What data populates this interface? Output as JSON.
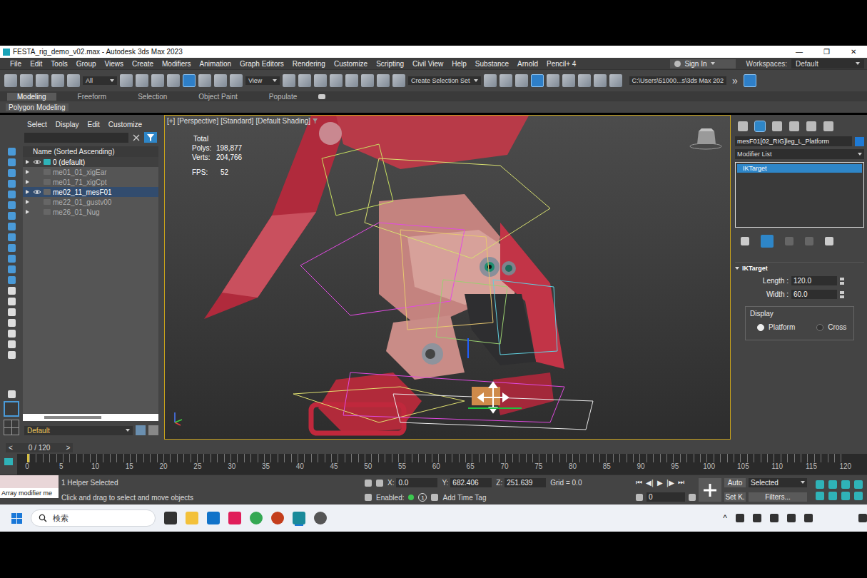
{
  "window": {
    "title": "FESTA_rig_demo_v02.max - Autodesk 3ds Max 2023",
    "controls": [
      "—",
      "❐",
      "✕"
    ]
  },
  "menu": [
    "File",
    "Edit",
    "Tools",
    "Group",
    "Views",
    "Create",
    "Modifiers",
    "Animation",
    "Graph Editors",
    "Rendering",
    "Customize",
    "Scripting",
    "Civil View",
    "Help",
    "Substance",
    "Arnold",
    "Pencil+ 4"
  ],
  "account": {
    "sign_in": "Sign In",
    "workspaces_label": "Workspaces:",
    "workspace": "Default"
  },
  "toolbar": {
    "selection_filter": "All",
    "reference_coord": "View",
    "selection_set": "Create Selection Set",
    "project_path": "C:\\Users\\51000...s\\3ds Max 202",
    "more": "»"
  },
  "ribbon": {
    "tabs": [
      {
        "label": "Modeling",
        "selected": true
      },
      {
        "label": "Freeform",
        "selected": false
      },
      {
        "label": "Selection",
        "selected": false
      },
      {
        "label": "Object Paint",
        "selected": false
      },
      {
        "label": "Populate",
        "selected": false
      }
    ],
    "panel": "Polygon Modeling"
  },
  "scene_explorer": {
    "menu": [
      "Select",
      "Display",
      "Edit",
      "Customize"
    ],
    "search_value": "",
    "column": "Name (Sorted Ascending)",
    "rows": [
      {
        "name": "0 (default)",
        "visible": true,
        "selected": false
      },
      {
        "name": "me01_01_xigEar",
        "visible": false,
        "selected": false
      },
      {
        "name": "me01_71_xigCpt",
        "visible": false,
        "selected": false
      },
      {
        "name": "me02_11_mesF01",
        "visible": true,
        "selected": true
      },
      {
        "name": "me22_01_gustv00",
        "visible": false,
        "selected": false
      },
      {
        "name": "me26_01_Nug",
        "visible": false,
        "selected": false
      }
    ],
    "layer": "Default"
  },
  "viewport": {
    "labels": [
      "[+]",
      "[Perspective]",
      "[Standard]",
      "[Default Shading]"
    ],
    "stats_title": "Total",
    "stats": [
      {
        "label": "Polys:",
        "value": "198,877"
      },
      {
        "label": "Verts:",
        "value": "204,766"
      }
    ],
    "fps_label": "FPS:",
    "fps": "52"
  },
  "command_panel": {
    "object_name": "mesF01[02_RIG]leg_L_Platform",
    "modifier_list": "Modifier List",
    "stack": [
      {
        "name": "IKTarget",
        "selected": true
      }
    ],
    "rollout": {
      "title": "IKTarget",
      "fields": [
        {
          "label": "Length :",
          "value": "120.0"
        },
        {
          "label": "Width :",
          "value": "60.0"
        }
      ],
      "group": "Display",
      "options": [
        {
          "label": "Platform",
          "selected": true
        },
        {
          "label": "Cross",
          "selected": false
        }
      ]
    }
  },
  "time_slider": {
    "label": "0 / 120",
    "prev": "<",
    "next": ">",
    "level": 0
  },
  "track_bar": {
    "ticks": [
      "0",
      "5",
      "10",
      "15",
      "20",
      "25",
      "30",
      "35",
      "40",
      "45",
      "50",
      "55",
      "60",
      "65",
      "70",
      "75",
      "80",
      "85",
      "90",
      "95",
      "100",
      "105",
      "110",
      "115",
      "120"
    ]
  },
  "status_bar": {
    "listener": "Array modifier me",
    "selection": "1 Helper Selected",
    "prompt": "Click and drag to select and move objects",
    "coords": [
      {
        "axis": "X:",
        "value": "0.0"
      },
      {
        "axis": "Y:",
        "value": "682.406"
      },
      {
        "axis": "Z:",
        "value": "251.639"
      }
    ],
    "grid": "Grid = 0.0",
    "enabled_label": "Enabled:",
    "enabled": true,
    "time_tag_count": "1",
    "add_time_tag": "Add Time Tag",
    "playback": [
      "⏮",
      "◀|",
      "▶",
      "|▶",
      "⏭"
    ],
    "frame": "0",
    "auto_key": "Auto",
    "key_filter": "Selected",
    "set_key": "Set K.",
    "filters": "Filters..."
  },
  "taskbar": {
    "search": "検索",
    "tray_chevron": "^"
  }
}
